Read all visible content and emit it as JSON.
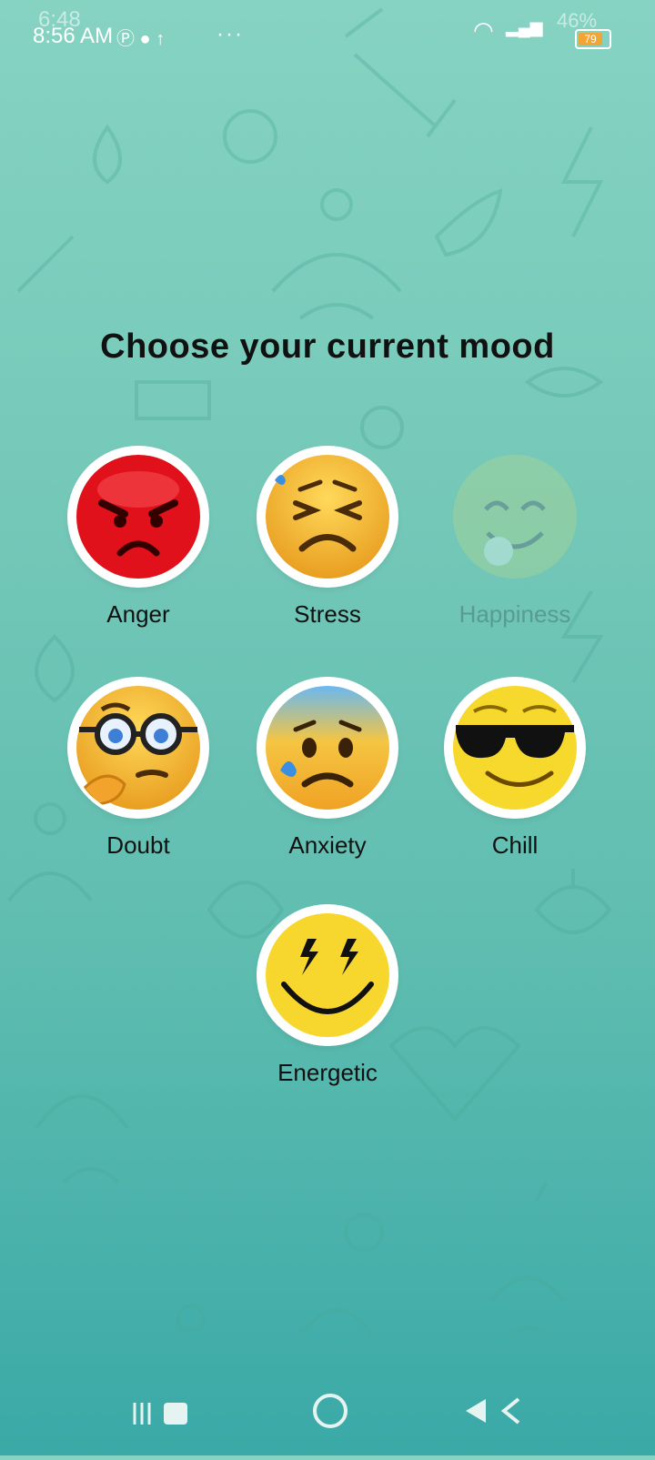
{
  "status_bar": {
    "time_primary": "8:56 AM",
    "time_secondary": "6:48",
    "battery_percent": "46%",
    "battery_level": "79",
    "overflow": "···",
    "vowifi": "Vo WiFi"
  },
  "page": {
    "title": "Choose your current mood"
  },
  "moods": [
    {
      "label": "Anger",
      "icon": "angry-face-icon"
    },
    {
      "label": "Stress",
      "icon": "stressed-face-icon"
    },
    {
      "label": "Happiness",
      "icon": "happy-face-icon",
      "state": "disabled"
    },
    {
      "label": "Doubt",
      "icon": "thinking-face-icon"
    },
    {
      "label": "Anxiety",
      "icon": "anxious-face-icon"
    },
    {
      "label": "Chill",
      "icon": "sunglasses-face-icon"
    },
    {
      "label": "Energetic",
      "icon": "energetic-face-icon"
    }
  ],
  "colors": {
    "background_top": "#86d3c2",
    "background_bottom": "#3aa9a7",
    "anger": "#e0111b",
    "emoji_yellow": "#f7c531"
  }
}
